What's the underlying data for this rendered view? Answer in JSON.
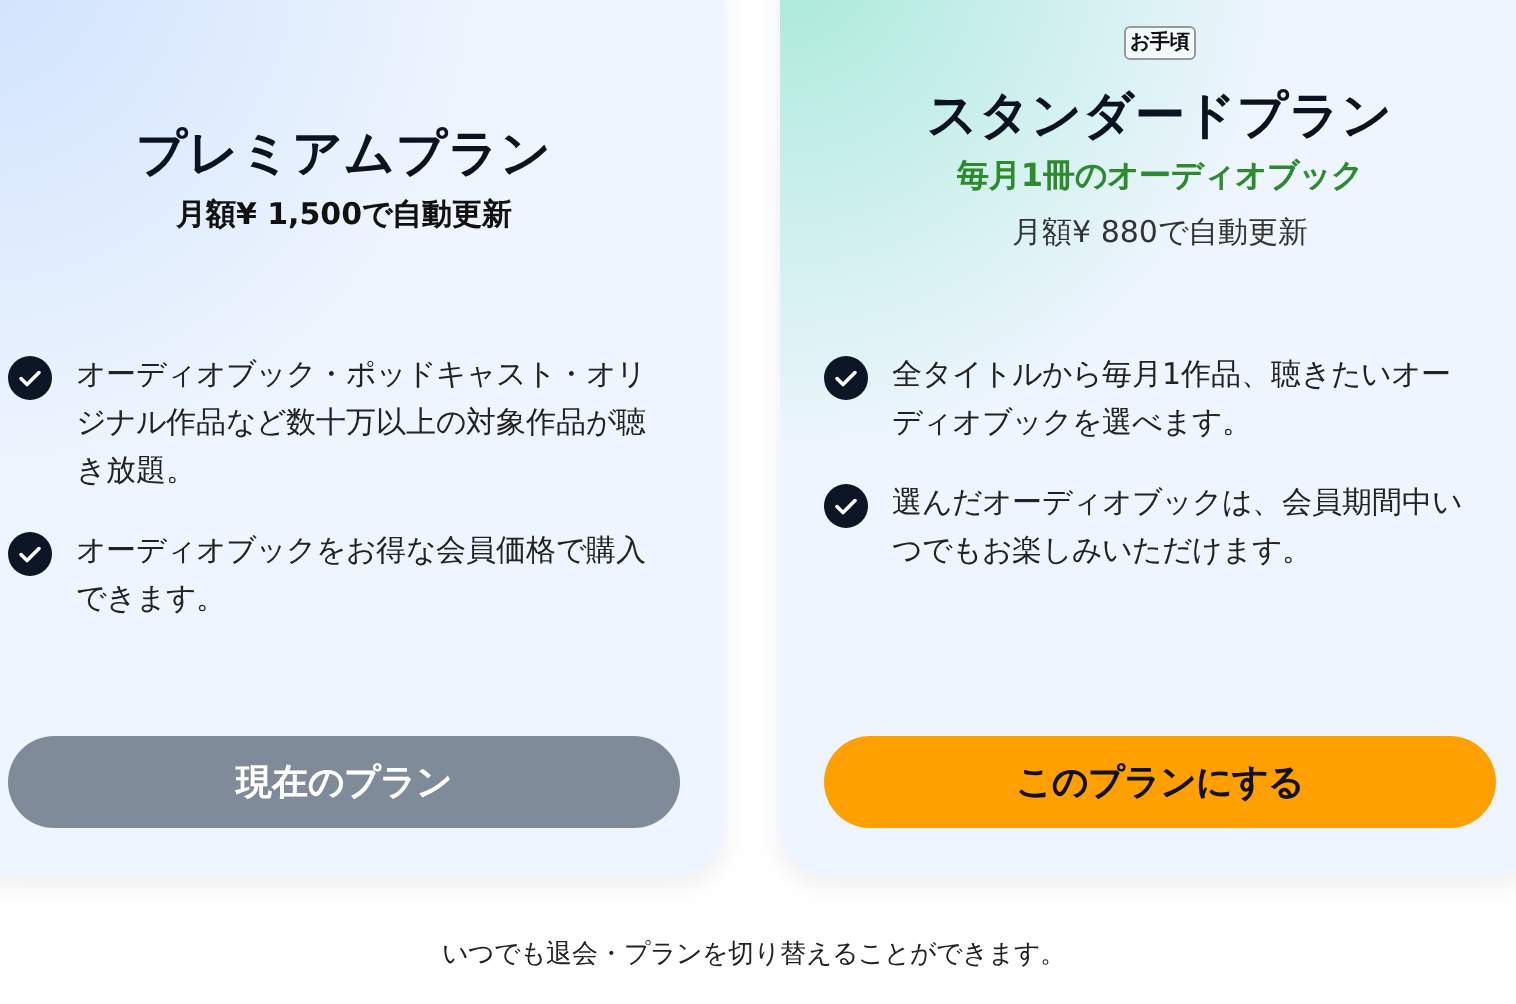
{
  "plans": [
    {
      "name": "プレミアムプラン",
      "price": "月額¥ 1,500で自動更新",
      "features": [
        "オーディオブック・ポッドキャスト・オリジナル作品など数十万以上の対象作品が聴き放題。",
        "オーディオブックをお得な会員価格で購入できます。"
      ],
      "button": "現在のプラン",
      "current": true
    },
    {
      "badge": "お手頃",
      "name": "スタンダードプラン",
      "highlight": "毎月1冊のオーディオブック",
      "price": "月額¥ 880で自動更新",
      "features": [
        "全タイトルから毎月1作品、聴きたいオーディオブックを選べます。",
        "選んだオーディオブックは、会員期間中いつでもお楽しみいただけます。"
      ],
      "button": "このプランにする",
      "current": false
    }
  ],
  "footer_note": "いつでも退会・プランを切り替えることができます。"
}
